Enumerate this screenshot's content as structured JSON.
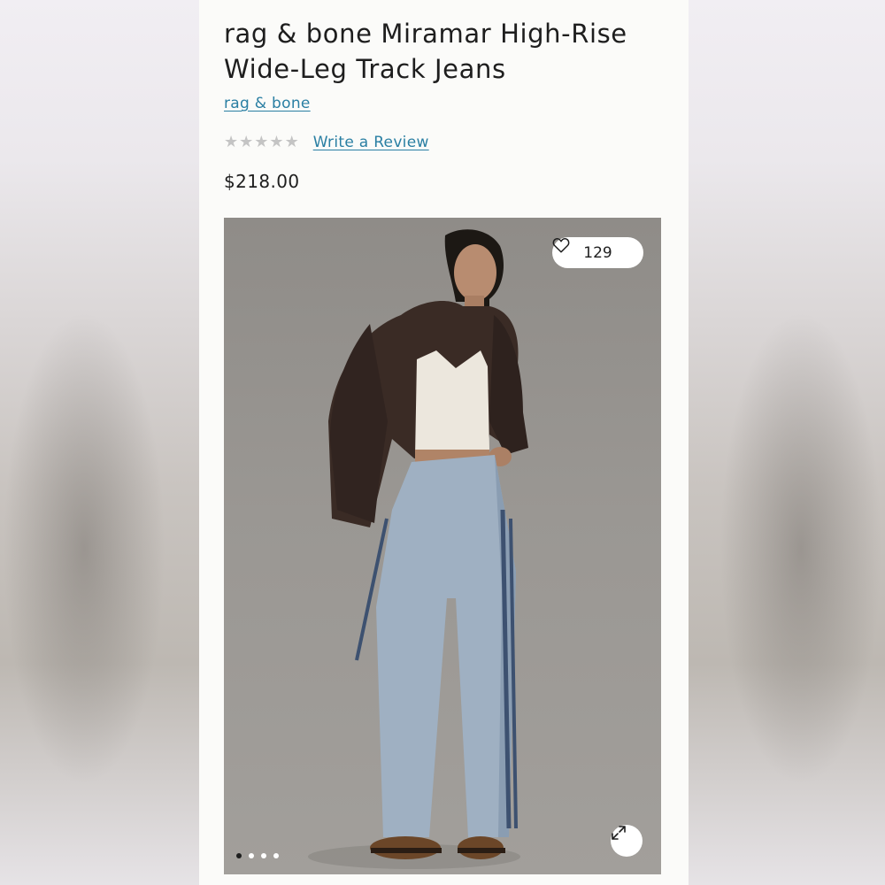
{
  "product": {
    "title": "rag & bone Miramar High-Rise Wide-Leg Track Jeans",
    "brand": "rag & bone",
    "rating": {
      "stars": 0,
      "max": 5
    },
    "review_link": "Write a Review",
    "price": "$218.00"
  },
  "gallery": {
    "like_count": "129",
    "like_icon": "heart-icon",
    "expand_icon": "expand-icon",
    "slide_count": 4,
    "active_slide": 1
  },
  "colors": {
    "link": "#2a7fa3",
    "star_empty": "#c4c4c4",
    "text": "#1e1e1e"
  }
}
